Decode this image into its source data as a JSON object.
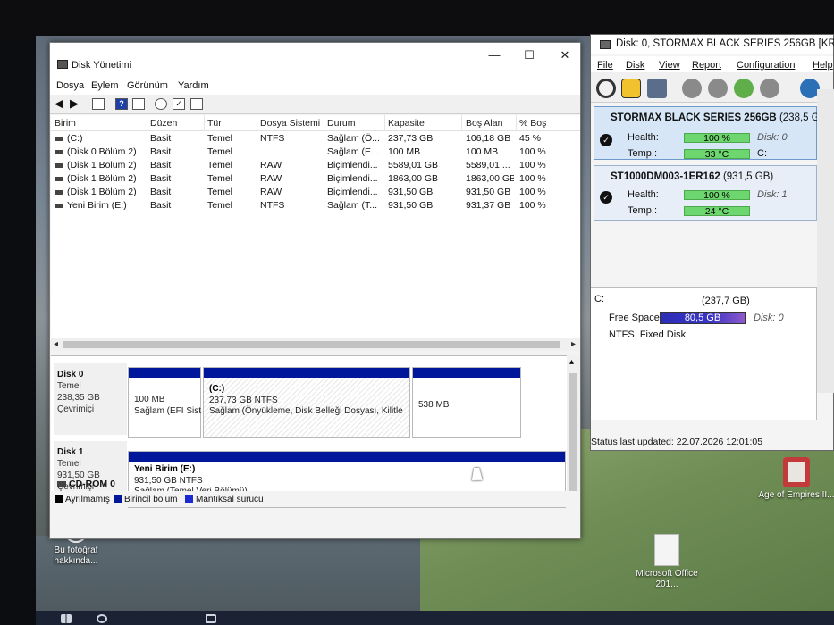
{
  "disk_management": {
    "title": "Disk Yönetimi",
    "window_buttons": {
      "minimize": "—",
      "maximize": "☐",
      "close": "✕"
    },
    "menu": [
      "Dosya",
      "Eylem",
      "Görünüm",
      "Yardım"
    ],
    "columns": [
      "Birim",
      "Düzen",
      "Tür",
      "Dosya Sistemi",
      "Durum",
      "Kapasite",
      "Boş Alan",
      "% Boş"
    ],
    "volumes": [
      [
        "(C:)",
        "Basit",
        "Temel",
        "NTFS",
        "Sağlam (Ö...",
        "237,73 GB",
        "106,18 GB",
        "45 %"
      ],
      [
        "(Disk 0 Bölüm 2)",
        "Basit",
        "Temel",
        "",
        "Sağlam (E...",
        "100 MB",
        "100 MB",
        "100 %"
      ],
      [
        "(Disk 1 Bölüm 2)",
        "Basit",
        "Temel",
        "RAW",
        "Biçimlendi...",
        "5589,01 GB",
        "5589,01 ...",
        "100 %"
      ],
      [
        "(Disk 1 Bölüm 2)",
        "Basit",
        "Temel",
        "RAW",
        "Biçimlendi...",
        "1863,00 GB",
        "1863,00 GB",
        "100 %"
      ],
      [
        "(Disk 1 Bölüm 2)",
        "Basit",
        "Temel",
        "RAW",
        "Biçimlendi...",
        "931,50 GB",
        "931,50 GB",
        "100 %"
      ],
      [
        "Yeni Birim (E:)",
        "Basit",
        "Temel",
        "NTFS",
        "Sağlam (T...",
        "931,50 GB",
        "931,37 GB",
        "100 %"
      ]
    ],
    "disk0": {
      "name": "Disk 0",
      "type": "Temel",
      "size": "238,35 GB",
      "state": "Çevrimiçi",
      "p1_size": "100 MB",
      "p1_status": "Sağlam (EFI Sist",
      "p2_name": "(C:)",
      "p2_size": "237,73 GB NTFS",
      "p2_status": "Sağlam (Önyükleme, Disk Belleği Dosyası, Kilitle",
      "p3_size": "538 MB"
    },
    "disk1": {
      "name": "Disk 1",
      "type": "Temel",
      "size": "931,50 GB",
      "state": "Çevrimiçi",
      "p1_name": "Yeni Birim  (E:)",
      "p1_size": "931,50 GB NTFS",
      "p1_status": "Sağlam (Temel Veri Bölümü)"
    },
    "cdrom": "CD-ROM 0",
    "legend": [
      "Ayrılmamış",
      "Birincil bölüm",
      "Mantıksal sürücü"
    ],
    "colors": {
      "primary": "#00169b",
      "unallocated": "#000000",
      "logical": "#1b2ad1"
    }
  },
  "disk_info": {
    "title": "Disk: 0, STORMAX BLACK SERIES 256GB [KR23020",
    "menu": [
      "File",
      "Disk",
      "View",
      "Report",
      "Configuration",
      "Help"
    ],
    "disks": [
      {
        "name": "STORMAX BLACK SERIES 256GB",
        "capacity": "(238,5 GB)",
        "health_label": "Health:",
        "health": "100 %",
        "disk_label": "Disk: 0",
        "temp_label": "Temp.:",
        "temp": "33 °C",
        "drive": "C:"
      },
      {
        "name": "ST1000DM003-1ER162",
        "capacity": "(931,5 GB)",
        "health_label": "Health:",
        "health": "100 %",
        "disk_label": "Disk: 1",
        "temp_label": "Temp.:",
        "temp": "24 °C",
        "drive": ""
      }
    ],
    "volume": {
      "letter": "C:",
      "size": "(237,7 GB)",
      "free_label": "Free Space",
      "free": "80,5 GB",
      "disk_label": "Disk: 0",
      "fs": "NTFS, Fixed Disk"
    },
    "status": "Status last updated: 22.07.2026 12:01:05",
    "colors": {
      "good": "#6ed66e",
      "free_bar": "#2d2db7"
    }
  },
  "desktop": {
    "icons": [
      {
        "label": "Bu fotoğraf hakkında...",
        "icon": "camera-icon"
      },
      {
        "label": "Age of Empires II...",
        "icon": "game-icon"
      },
      {
        "label": "Microsoft Office 201...",
        "icon": "document-icon"
      }
    ]
  }
}
